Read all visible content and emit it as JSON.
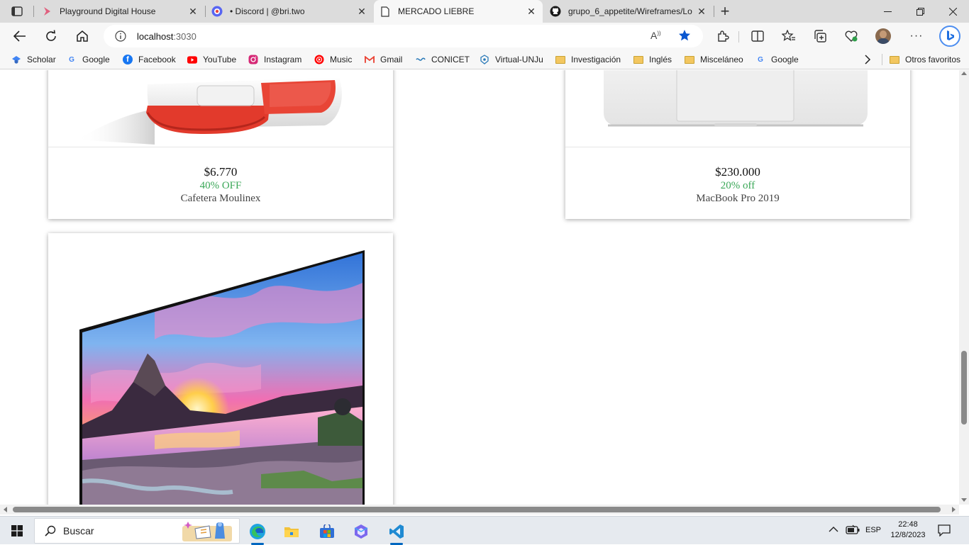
{
  "browser": {
    "tabs": [
      {
        "title": "Playground Digital House",
        "icon": "digital-house-icon"
      },
      {
        "title": "• Discord | @bri.two",
        "icon": "discord-icon"
      },
      {
        "title": "MERCADO LIEBRE",
        "icon": "page-icon",
        "active": true
      },
      {
        "title": "grupo_6_appetite/Wireframes/Lo",
        "icon": "github-icon"
      }
    ],
    "address": {
      "host": "localhost",
      "port": ":3030"
    },
    "bookmarks": [
      {
        "label": "Scholar",
        "icon": "scholar-icon",
        "color": "#4285f4"
      },
      {
        "label": "Google",
        "icon": "google-icon",
        "color": "#4285f4"
      },
      {
        "label": "Facebook",
        "icon": "facebook-icon",
        "color": "#1877f2"
      },
      {
        "label": "YouTube",
        "icon": "youtube-icon",
        "color": "#ff0000"
      },
      {
        "label": "Instagram",
        "icon": "instagram-icon",
        "color": "#d62976"
      },
      {
        "label": "Music",
        "icon": "music-icon",
        "color": "#ff0000"
      },
      {
        "label": "Gmail",
        "icon": "gmail-icon",
        "color": "#ea4335"
      },
      {
        "label": "CONICET",
        "icon": "conicet-icon",
        "color": "#2a7ab8"
      },
      {
        "label": "Virtual-UNJu",
        "icon": "unju-icon",
        "color": "#2a7ab8"
      },
      {
        "label": "Investigación",
        "icon": "folder-icon"
      },
      {
        "label": "Inglés",
        "icon": "folder-icon"
      },
      {
        "label": "Misceláneo",
        "icon": "folder-icon"
      },
      {
        "label": "Google",
        "icon": "google-icon",
        "color": "#4285f4"
      }
    ],
    "other_favorites": "Otros favoritos"
  },
  "products": [
    {
      "price": "$6.770",
      "discount": "40% OFF",
      "name": "Cafetera Moulinex",
      "image": "coffee-maker-image"
    },
    {
      "price": "$230.000",
      "discount": "20% off",
      "name": "MacBook Pro 2019",
      "image": "laptop-image"
    },
    {
      "image": "tv-image"
    }
  ],
  "taskbar": {
    "search_label": "Buscar",
    "language": "ESP",
    "time": "22:48",
    "date": "12/8/2023"
  },
  "colors": {
    "discount_green": "#3aa757",
    "accent_blue": "#0b57d0"
  }
}
